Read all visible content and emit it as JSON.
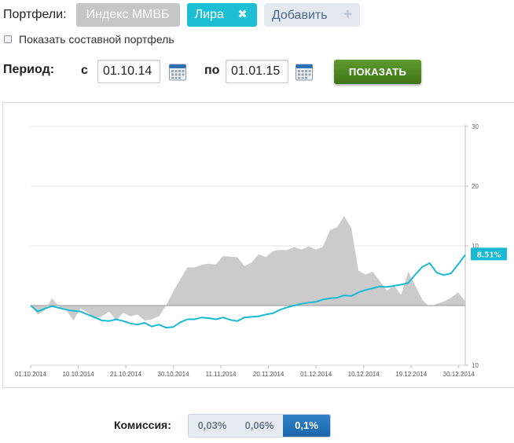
{
  "portfolios": {
    "label": "Портфели:",
    "chips": [
      {
        "label": "Индекс ММВБ"
      },
      {
        "label": "Лира",
        "remove": "✖"
      },
      {
        "label": "Добавить",
        "add": "+"
      }
    ]
  },
  "composite": {
    "label": "Показать составной портфель",
    "checked": false
  },
  "period": {
    "label": "Период:",
    "from_label": "с",
    "from_value": "01.10.14",
    "to_label": "по",
    "to_value": "01.01.15",
    "show_button": "ПОКАЗАТЬ"
  },
  "chart_data": {
    "type": "area",
    "title": "",
    "xlabel": "",
    "ylabel": "",
    "x_ticks": [
      "01.10.2014",
      "10.10.2014",
      "21.10.2014",
      "30.10.2014",
      "11.11.2014",
      "20.11.2014",
      "01.12.2014",
      "10.12.2014",
      "19.12.2014",
      "30.12.2014"
    ],
    "y_ticks": [
      "30",
      "20",
      "10",
      "10"
    ],
    "ylim": [
      -10,
      30
    ],
    "grid": true,
    "end_label": "8.51%",
    "colors": {
      "index": "#cbcbcb",
      "portfolio": "#19b9d3"
    },
    "series": [
      {
        "values": [
          0.0,
          -1.5,
          -0.8,
          1.2,
          -0.2,
          -0.8,
          -2.5,
          -0.5,
          -1.2,
          -2.2,
          -1.8,
          -1.0,
          -2.5,
          -1.2,
          -1.8,
          -1.5,
          -2.5,
          -2.3,
          -1.8,
          0.0,
          2.3,
          4.4,
          6.4,
          6.4,
          6.8,
          7.0,
          6.9,
          8.3,
          8.2,
          8.1,
          6.6,
          7.2,
          8.6,
          8.1,
          9.1,
          9.3,
          9.3,
          9.8,
          9.4,
          9.9,
          9.4,
          9.8,
          12.6,
          13.1,
          15.0,
          13.0,
          5.9,
          5.2,
          5.7,
          4.1,
          2.5,
          3.4,
          1.8,
          5.7,
          3.3,
          0.9,
          -0.2,
          0.3,
          0.7,
          1.3,
          2.2,
          0.7
        ]
      },
      {
        "values": [
          0.0,
          -1.0,
          -0.5,
          -0.1,
          -0.4,
          -0.7,
          -0.9,
          -1.0,
          -1.5,
          -2.0,
          -2.5,
          -2.6,
          -2.3,
          -2.6,
          -3.0,
          -3.2,
          -2.9,
          -3.5,
          -3.2,
          -3.7,
          -3.6,
          -2.8,
          -2.3,
          -2.3,
          -2.0,
          -2.1,
          -2.3,
          -2.0,
          -2.4,
          -2.6,
          -2.0,
          -1.9,
          -1.8,
          -1.5,
          -1.3,
          -0.7,
          -0.3,
          0.0,
          0.3,
          0.5,
          0.6,
          1.0,
          1.2,
          1.3,
          1.7,
          1.6,
          2.2,
          2.6,
          2.9,
          3.2,
          3.1,
          3.3,
          3.5,
          3.8,
          5.2,
          6.5,
          7.1,
          5.5,
          5.1,
          5.4,
          6.9,
          8.51
        ]
      }
    ]
  },
  "commission": {
    "label": "Комиссия:",
    "options": [
      "0,03%",
      "0,06%",
      "0,1%"
    ],
    "selected": 2
  }
}
